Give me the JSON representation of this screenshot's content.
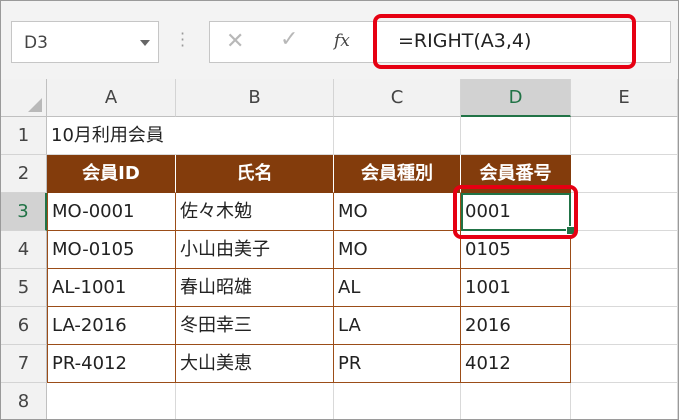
{
  "name_box": {
    "value": "D3"
  },
  "formula_bar": {
    "cancel_glyph": "✕",
    "enter_glyph": "✓",
    "fx_label": "fx",
    "formula": "=RIGHT(A3,4)"
  },
  "columns": [
    "A",
    "B",
    "C",
    "D",
    "E"
  ],
  "rows": [
    "1",
    "2",
    "3",
    "4",
    "5",
    "6",
    "7",
    "8"
  ],
  "sheet": {
    "title": "10月利用会員",
    "headers": [
      "会員ID",
      "氏名",
      "会員種別",
      "会員番号"
    ],
    "records": [
      [
        "MO-0001",
        "佐々木勉",
        "MO",
        "0001"
      ],
      [
        "MO-0105",
        "小山由美子",
        "MO",
        "0105"
      ],
      [
        "AL-1001",
        "春山昭雄",
        "AL",
        "1001"
      ],
      [
        "LA-2016",
        "冬田幸三",
        "LA",
        "2016"
      ],
      [
        "PR-4012",
        "大山美恵",
        "PR",
        "4012"
      ]
    ]
  },
  "colors": {
    "header_fill": "#833c0c",
    "highlight": "#e60012",
    "active_cell": "#217346"
  }
}
